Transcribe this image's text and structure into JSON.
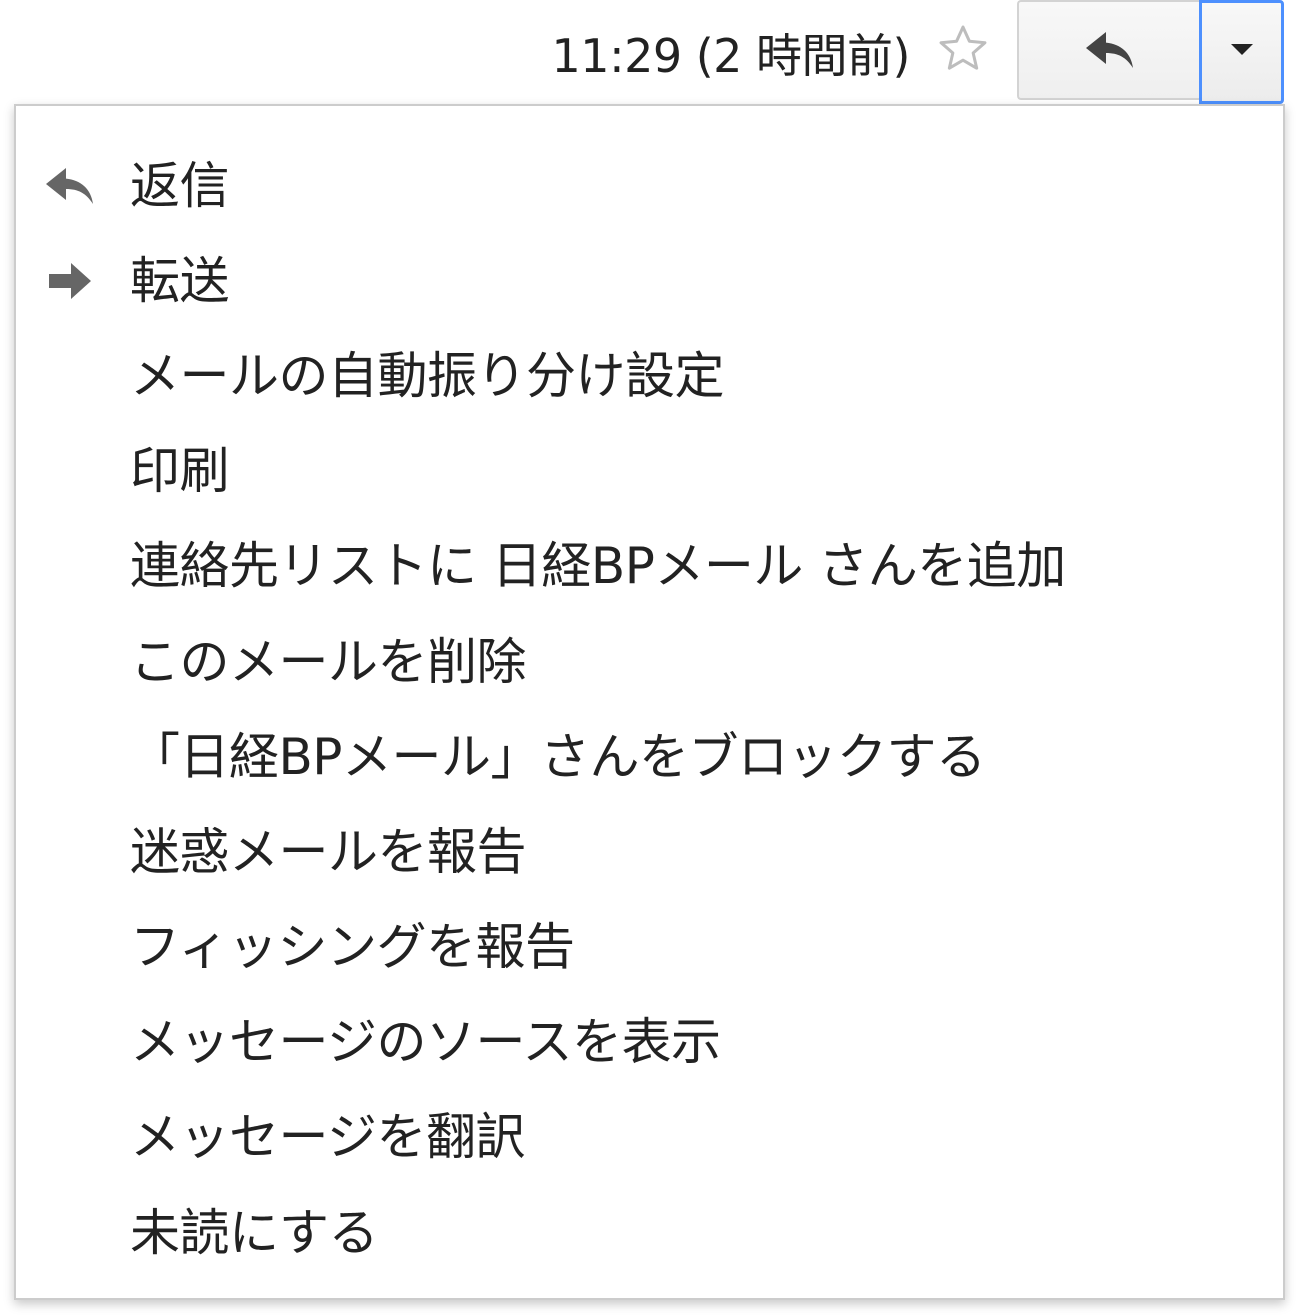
{
  "header": {
    "timestamp": "11:29 (2 時間前)",
    "star_icon": "star-outline-icon",
    "reply_icon": "reply-icon",
    "more_icon": "caret-down-icon"
  },
  "menu": {
    "items": [
      {
        "label": "返信",
        "icon": "reply-icon"
      },
      {
        "label": "転送",
        "icon": "forward-icon"
      },
      {
        "label": "メールの自動振り分け設定"
      },
      {
        "label": "印刷"
      },
      {
        "label": "連絡先リストに 日経BPメール さんを追加"
      },
      {
        "label": "このメールを削除"
      },
      {
        "label": "「日経BPメール」さんをブロックする"
      },
      {
        "label": "迷惑メールを報告"
      },
      {
        "label": "フィッシングを報告"
      },
      {
        "label": "メッセージのソースを表示"
      },
      {
        "label": "メッセージを翻訳"
      },
      {
        "label": "未読にする"
      }
    ]
  },
  "colors": {
    "focus_border": "#4d90fe",
    "icon_gray": "#666666",
    "text": "#222222"
  }
}
